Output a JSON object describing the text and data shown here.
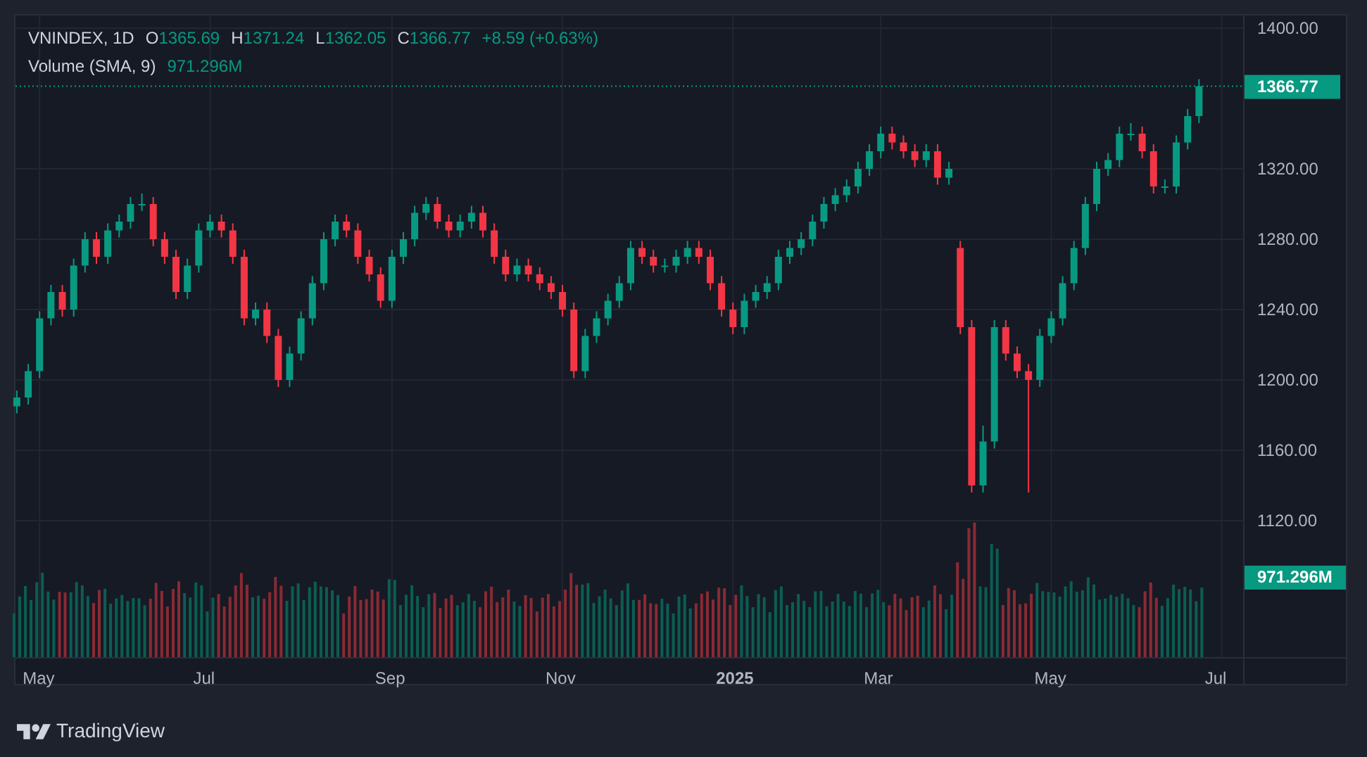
{
  "legend": {
    "symbol": "VNINDEX, 1D",
    "fields": [
      {
        "label": "O",
        "value": "1365.69"
      },
      {
        "label": "H",
        "value": "1371.24"
      },
      {
        "label": "L",
        "value": "1362.05"
      },
      {
        "label": "C",
        "value": "1366.77"
      }
    ],
    "change": "+8.59 (+0.63%)",
    "study": "Volume (SMA, 9)",
    "study_value": "971.296M"
  },
  "chart": {
    "last_price_badge": "1366.77",
    "volume_badge": "971.296M",
    "chart_data": {
      "type": "candlestick",
      "grid": true,
      "ylim": [
        1042.4,
        1407.2
      ],
      "yticks": [
        {
          "value": 1400,
          "label": "1400.00"
        },
        {
          "value": 1320,
          "label": "1320.00"
        },
        {
          "value": 1280,
          "label": "1280.00"
        },
        {
          "value": 1240,
          "label": "1240.00"
        },
        {
          "value": 1200,
          "label": "1200.00"
        },
        {
          "value": 1160,
          "label": "1160.00"
        },
        {
          "value": 1120,
          "label": "1120.00"
        }
      ],
      "categories": [
        null,
        null,
        "May",
        null,
        null,
        null,
        null,
        null,
        null,
        null,
        null,
        null,
        null,
        null,
        null,
        null,
        null,
        "Jul",
        null,
        null,
        null,
        null,
        null,
        null,
        null,
        null,
        null,
        null,
        null,
        null,
        null,
        null,
        null,
        "Sep",
        null,
        null,
        null,
        null,
        null,
        null,
        null,
        null,
        null,
        null,
        null,
        null,
        null,
        null,
        "Nov",
        null,
        null,
        null,
        null,
        null,
        null,
        null,
        null,
        null,
        null,
        null,
        null,
        null,
        null,
        "2025",
        null,
        null,
        null,
        null,
        null,
        null,
        null,
        null,
        null,
        null,
        null,
        null,
        "Mar",
        null,
        null,
        null,
        null,
        null,
        null,
        null,
        null,
        null,
        null,
        null,
        null,
        null,
        null,
        "May",
        null,
        null,
        null,
        null,
        null,
        null,
        null,
        null,
        null,
        null,
        null,
        null,
        null,
        null,
        "Jul"
      ],
      "ohlc": [
        [
          1185,
          1194,
          1181,
          1190
        ],
        [
          1190,
          1209,
          1186,
          1205
        ],
        [
          1205,
          1239,
          1201,
          1235
        ],
        [
          1235,
          1254,
          1231,
          1250
        ],
        [
          1250,
          1254,
          1236,
          1240
        ],
        [
          1240,
          1269,
          1236,
          1265
        ],
        [
          1265,
          1284,
          1261,
          1280
        ],
        [
          1280,
          1284,
          1266,
          1270
        ],
        [
          1270,
          1289,
          1266,
          1285
        ],
        [
          1285,
          1294,
          1281,
          1290
        ],
        [
          1290,
          1304,
          1286,
          1300
        ],
        [
          1300,
          1306,
          1296,
          1300
        ],
        [
          1300,
          1304,
          1276,
          1280
        ],
        [
          1280,
          1284,
          1266,
          1270
        ],
        [
          1270,
          1274,
          1246,
          1250
        ],
        [
          1250,
          1269,
          1246,
          1265
        ],
        [
          1265,
          1289,
          1261,
          1285
        ],
        [
          1285,
          1294,
          1281,
          1290
        ],
        [
          1290,
          1294,
          1281,
          1285
        ],
        [
          1285,
          1289,
          1266,
          1270
        ],
        [
          1270,
          1274,
          1231,
          1235
        ],
        [
          1235,
          1244,
          1231,
          1240
        ],
        [
          1240,
          1244,
          1221,
          1225
        ],
        [
          1225,
          1229,
          1196,
          1200
        ],
        [
          1200,
          1219,
          1196,
          1215
        ],
        [
          1215,
          1239,
          1211,
          1235
        ],
        [
          1235,
          1259,
          1231,
          1255
        ],
        [
          1255,
          1284,
          1251,
          1280
        ],
        [
          1280,
          1294,
          1276,
          1290
        ],
        [
          1290,
          1294,
          1281,
          1285
        ],
        [
          1285,
          1289,
          1266,
          1270
        ],
        [
          1270,
          1274,
          1256,
          1260
        ],
        [
          1260,
          1264,
          1241,
          1245
        ],
        [
          1245,
          1274,
          1241,
          1270
        ],
        [
          1270,
          1284,
          1266,
          1280
        ],
        [
          1280,
          1299,
          1276,
          1295
        ],
        [
          1295,
          1304,
          1291,
          1300
        ],
        [
          1300,
          1304,
          1286,
          1290
        ],
        [
          1290,
          1294,
          1281,
          1285
        ],
        [
          1285,
          1294,
          1281,
          1290
        ],
        [
          1290,
          1299,
          1286,
          1295
        ],
        [
          1295,
          1299,
          1281,
          1285
        ],
        [
          1285,
          1289,
          1266,
          1270
        ],
        [
          1270,
          1274,
          1256,
          1260
        ],
        [
          1260,
          1269,
          1256,
          1265
        ],
        [
          1265,
          1269,
          1256,
          1260
        ],
        [
          1260,
          1264,
          1251,
          1255
        ],
        [
          1255,
          1259,
          1246,
          1250
        ],
        [
          1250,
          1254,
          1236,
          1240
        ],
        [
          1240,
          1244,
          1201,
          1205
        ],
        [
          1205,
          1229,
          1201,
          1225
        ],
        [
          1225,
          1239,
          1221,
          1235
        ],
        [
          1235,
          1249,
          1231,
          1245
        ],
        [
          1245,
          1259,
          1241,
          1255
        ],
        [
          1255,
          1279,
          1251,
          1275
        ],
        [
          1275,
          1279,
          1266,
          1270
        ],
        [
          1270,
          1274,
          1261,
          1265
        ],
        [
          1265,
          1269,
          1261,
          1265
        ],
        [
          1265,
          1274,
          1261,
          1270
        ],
        [
          1270,
          1279,
          1266,
          1275
        ],
        [
          1275,
          1279,
          1266,
          1270
        ],
        [
          1270,
          1274,
          1251,
          1255
        ],
        [
          1255,
          1259,
          1236,
          1240
        ],
        [
          1240,
          1244,
          1226,
          1230
        ],
        [
          1230,
          1249,
          1226,
          1245
        ],
        [
          1245,
          1254,
          1241,
          1250
        ],
        [
          1250,
          1259,
          1246,
          1255
        ],
        [
          1255,
          1274,
          1251,
          1270
        ],
        [
          1270,
          1279,
          1266,
          1275
        ],
        [
          1275,
          1284,
          1271,
          1280
        ],
        [
          1280,
          1294,
          1276,
          1290
        ],
        [
          1290,
          1304,
          1286,
          1300
        ],
        [
          1300,
          1309,
          1296,
          1305
        ],
        [
          1305,
          1314,
          1301,
          1310
        ],
        [
          1310,
          1324,
          1306,
          1320
        ],
        [
          1320,
          1334,
          1316,
          1330
        ],
        [
          1330,
          1344,
          1326,
          1340
        ],
        [
          1340,
          1344,
          1331,
          1335
        ],
        [
          1335,
          1339,
          1326,
          1330
        ],
        [
          1330,
          1334,
          1321,
          1325
        ],
        [
          1325,
          1334,
          1321,
          1330
        ],
        [
          1330,
          1334,
          1311,
          1315
        ],
        [
          1315,
          1324,
          1311,
          1320
        ],
        [
          1275,
          1279,
          1226,
          1230
        ],
        [
          1230,
          1234,
          1136,
          1140
        ],
        [
          1140,
          1174,
          1136,
          1165
        ],
        [
          1165,
          1234,
          1161,
          1230
        ],
        [
          1230,
          1234,
          1211,
          1215
        ],
        [
          1215,
          1219,
          1201,
          1205
        ],
        [
          1205,
          1209,
          1136,
          1200
        ],
        [
          1200,
          1229,
          1196,
          1225
        ],
        [
          1225,
          1239,
          1221,
          1235
        ],
        [
          1235,
          1259,
          1231,
          1255
        ],
        [
          1255,
          1279,
          1251,
          1275
        ],
        [
          1275,
          1304,
          1271,
          1300
        ],
        [
          1300,
          1324,
          1296,
          1320
        ],
        [
          1320,
          1329,
          1316,
          1325
        ],
        [
          1325,
          1344,
          1321,
          1340
        ],
        [
          1340,
          1346,
          1336,
          1340
        ],
        [
          1340,
          1344,
          1326,
          1330
        ],
        [
          1330,
          1334,
          1306,
          1310
        ],
        [
          1310,
          1314,
          1306,
          1310
        ],
        [
          1310,
          1339,
          1306,
          1335
        ],
        [
          1335,
          1354,
          1331,
          1350
        ],
        [
          1350,
          1371,
          1346,
          1367
        ],
        null,
        null
      ]
    }
  },
  "footer": {
    "brand": "TradingView"
  }
}
